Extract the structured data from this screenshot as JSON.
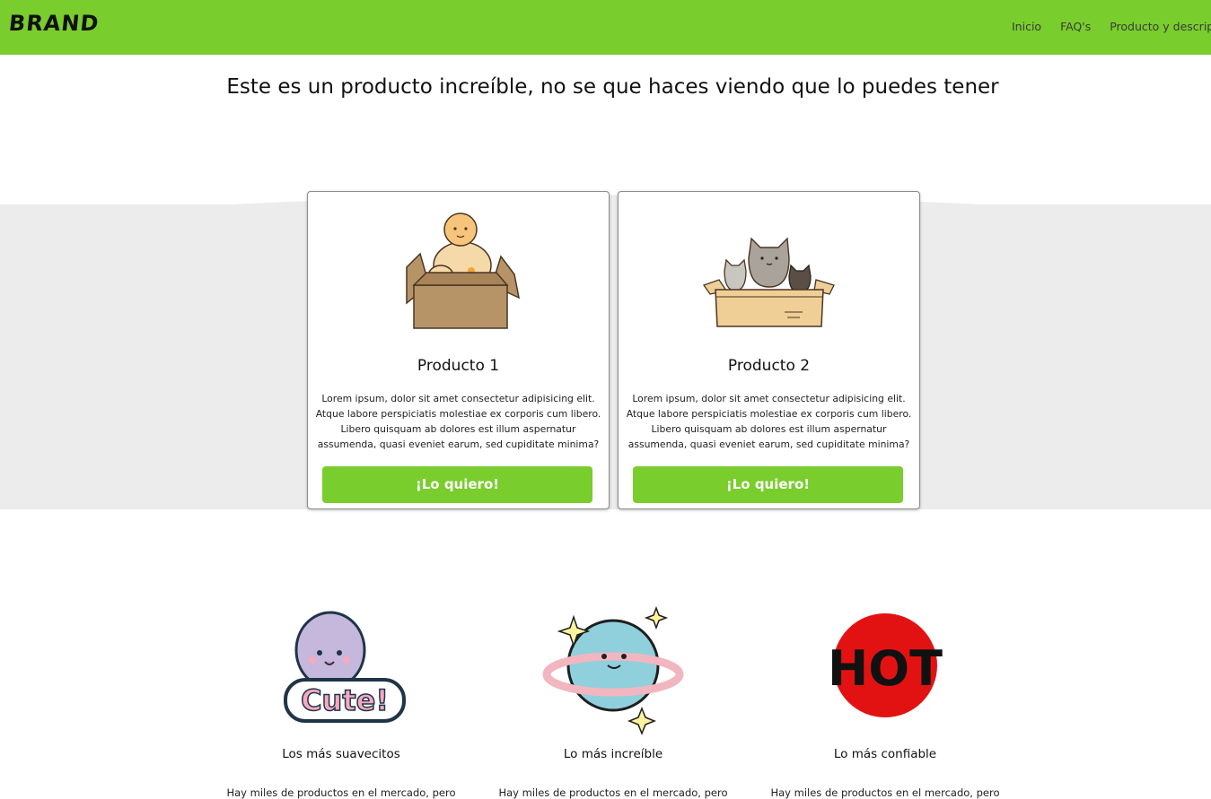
{
  "nav": {
    "brand": "BRAND",
    "links": [
      "Inicio",
      "FAQ's",
      "Producto y descripción"
    ]
  },
  "hero": {
    "headline": "Este es un producto increíble, no se que haces viendo que lo puedes tener"
  },
  "products": [
    {
      "title": "Producto 1",
      "description": "Lorem ipsum, dolor sit amet consectetur adipisicing elit. Atque labore perspiciatis molestiae ex corporis cum libero. Libero quisquam ab dolores est illum aspernatur assumenda, quasi eveniet earum, sed cupiditate minima?",
      "button": "¡Lo quiero!",
      "image_icon": "baby-in-box-illustration"
    },
    {
      "title": "Producto 2",
      "description": "Lorem ipsum, dolor sit amet consectetur adipisicing elit. Atque labore perspiciatis molestiae ex corporis cum libero. Libero quisquam ab dolores est illum aspernatur assumenda, quasi eveniet earum, sed cupiditate minima?",
      "button": "¡Lo quiero!",
      "image_icon": "cats-in-box-illustration"
    }
  ],
  "features": [
    {
      "title": "Los más suavecitos",
      "text": "Hay miles de productos en el mercado, pero",
      "image_icon": "cute-sticker",
      "sticker_text": "Cute!"
    },
    {
      "title": "Lo más increíble",
      "text": "Hay miles de productos en el mercado, pero",
      "image_icon": "planet-sticker"
    },
    {
      "title": "Lo más confiable",
      "text": "Hay miles de productos en el mercado, pero",
      "image_icon": "hot-sticker",
      "sticker_text": "HOT"
    }
  ],
  "colors": {
    "brand_green": "#79cd2c",
    "band_gray": "#ececec",
    "hot_red": "#e31212"
  }
}
